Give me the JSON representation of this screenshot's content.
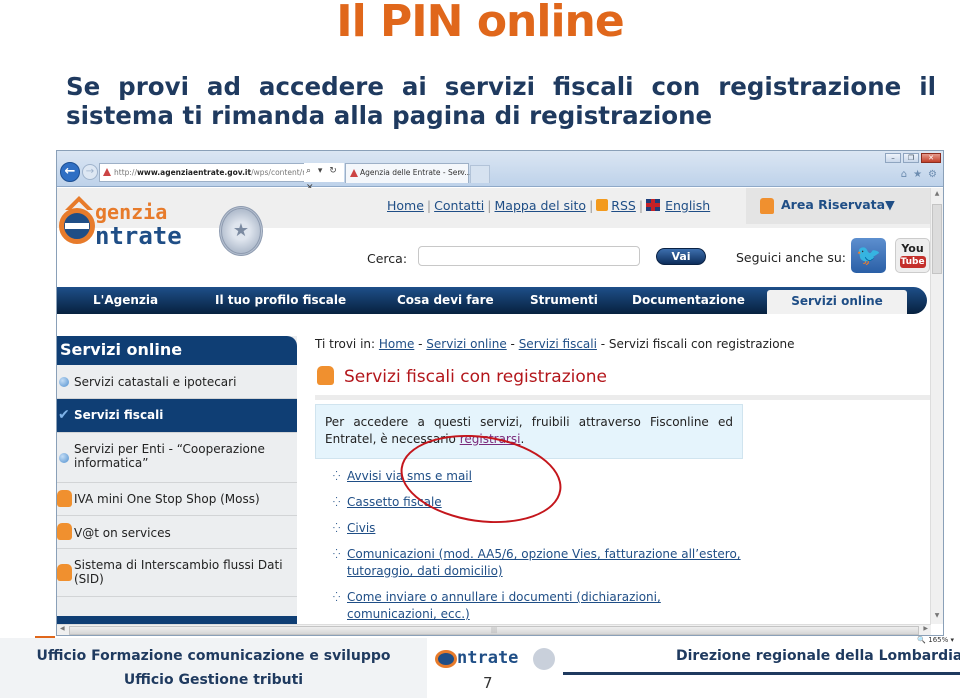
{
  "slide": {
    "title": "Il PIN online",
    "subtitle": "Se provi ad accedere ai servizi fiscali con registrazione il sistema ti rimanda alla pagina  di registrazione"
  },
  "browser": {
    "url_prefix": "http://",
    "url_domain": "www.agenziaentrate.gov.it",
    "url_path": "/wps/content/nsilib/nsi/home/",
    "address_tools": "⌕ ▾ ↻ ✕",
    "tab_title": "Agenzia delle Entrate - Serv...",
    "tab_close": "×",
    "back_icon": "←",
    "forward_icon": "→",
    "window_buttons": [
      "–",
      "❐",
      "✕"
    ],
    "toolbar_icons": [
      "⌂",
      "★",
      "⚙"
    ],
    "zoom_level": "165%"
  },
  "site": {
    "logo_top": "genzia",
    "logo_bottom": "ntrate",
    "top_links": [
      "Home",
      "Contatti",
      "Mappa del sito",
      "RSS",
      "English"
    ],
    "area_riservata": "Area Riservata▼",
    "search_label": "Cerca:",
    "search_value": "",
    "search_button": "Vai",
    "follow_label": "Seguici anche su:",
    "youtube_top": "You",
    "youtube_bottom": "Tube",
    "main_nav": [
      "L'Agenzia",
      "Il tuo profilo fiscale",
      "Cosa devi fare",
      "Strumenti",
      "Documentazione",
      "Servizi online"
    ],
    "main_nav_active": "Servizi online"
  },
  "sidebar": {
    "heading": "Servizi online",
    "items": [
      {
        "label": "Servizi catastali e ipotecari",
        "icon": "bullet"
      },
      {
        "label": "Servizi fiscali",
        "icon": "check",
        "active": true
      },
      {
        "label": "Servizi per Enti - “Cooperazione informatica”",
        "icon": "bullet"
      },
      {
        "label": "IVA mini One Stop Shop (Moss)",
        "icon": "lock"
      },
      {
        "label": "V@t on services",
        "icon": "lock"
      },
      {
        "label": "Sistema di Interscambio flussi Dati (SID)",
        "icon": "lock"
      }
    ]
  },
  "content": {
    "breadcrumb_prefix": "Ti trovi in:",
    "breadcrumb": [
      "Home",
      "Servizi online",
      "Servizi fiscali",
      "Servizi fiscali con registrazione"
    ],
    "breadcrumb_sep": " - ",
    "title": "Servizi fiscali con registrazione",
    "info_text_before": "Per accedere a questi servizi, fruibili attraverso Fisconline ed Entratel, è necessario ",
    "info_link": "registrarsi",
    "info_text_after": ".",
    "links": [
      "Avvisi via sms e mail",
      "Cassetto fiscale",
      "Civis",
      "Comunicazioni (mod. AA5/6, opzione Vies, fatturazione all’estero, tutoraggio, dati domicilio)",
      "Come inviare o annullare i documenti (dichiarazioni, comunicazioni, ecc.)"
    ],
    "link_bullet": "⁛"
  },
  "footer": {
    "left_line1": "Ufficio Formazione comunicazione e sviluppo",
    "left_line2": "Ufficio Gestione tributi",
    "logo_text": "ntrate",
    "page_number": "7",
    "right": "Direzione regionale della Lombardia"
  },
  "colors": {
    "title_orange": "#e0671b",
    "navy": "#1f3a5f",
    "site_blue": "#1f4e86",
    "highlight_red": "#c4161c"
  }
}
